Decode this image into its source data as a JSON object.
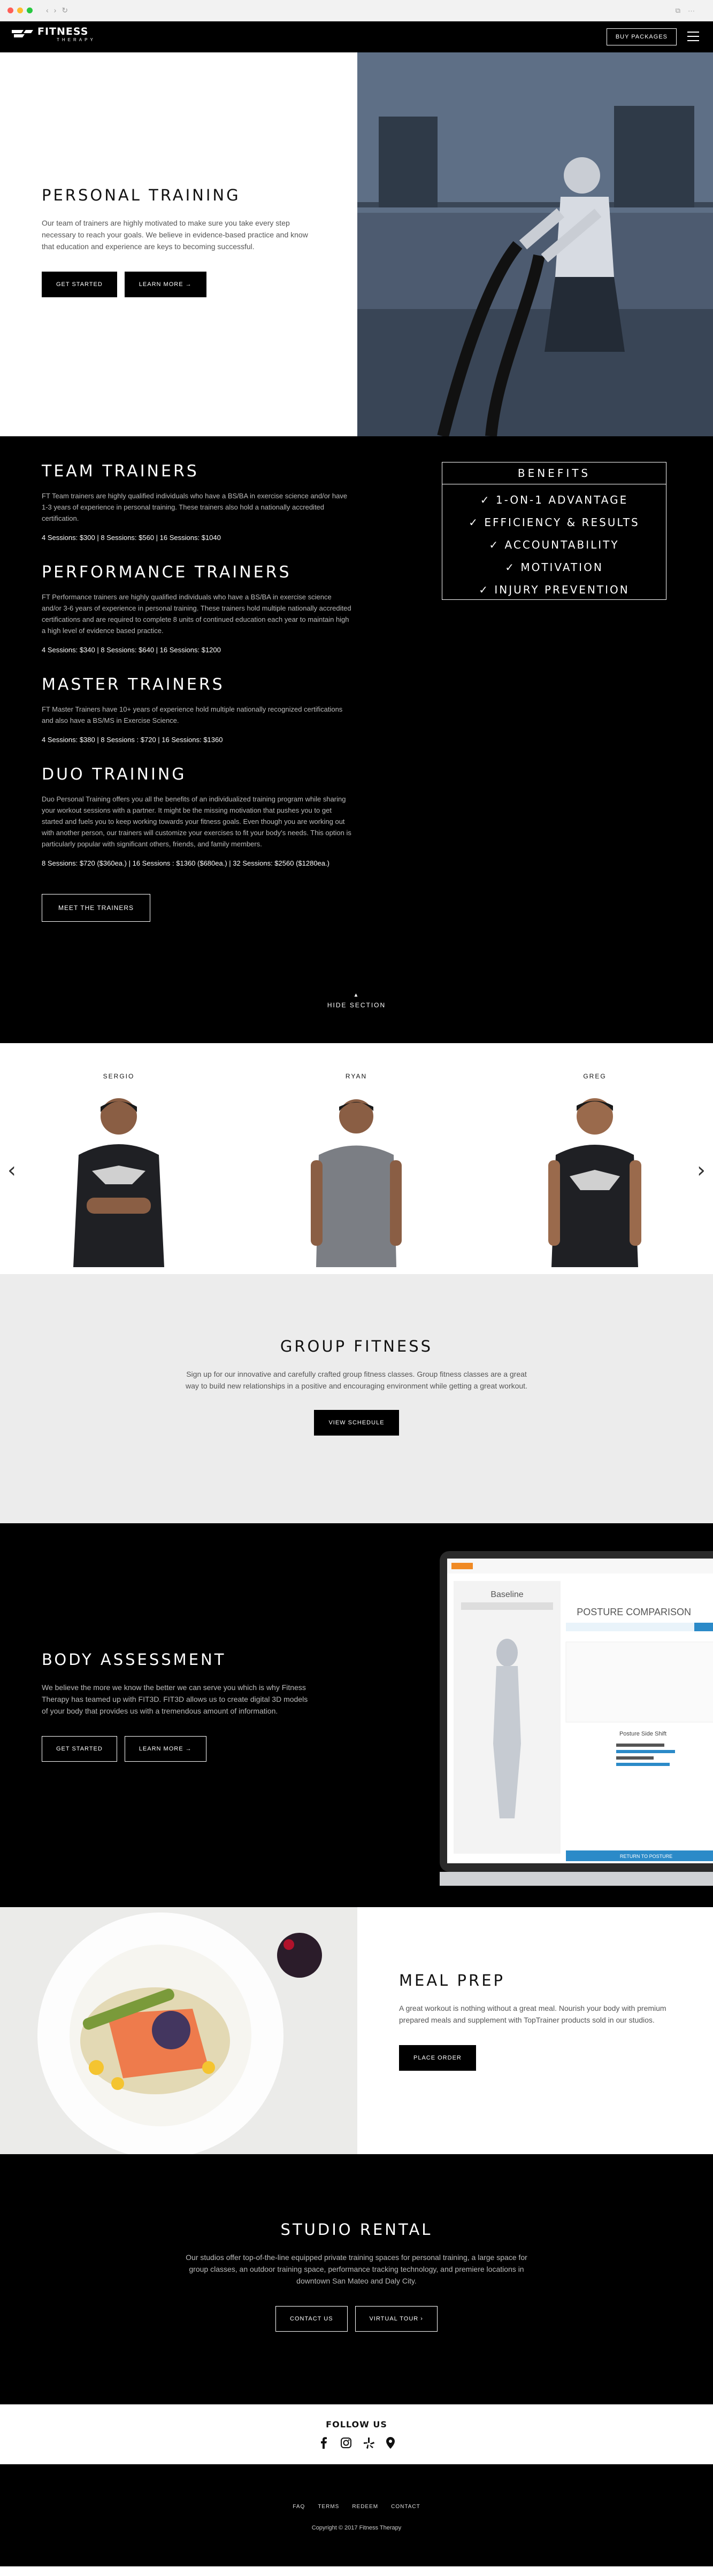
{
  "header": {
    "logo_title": "FITNESS",
    "logo_subtitle": "THERAPY",
    "buy_label": "BUY PACKAGES"
  },
  "personal_training": {
    "title": "PERSONAL TRAINING",
    "text": "Our team of trainers are highly motivated to make sure you take every step necessary to reach your goals. We believe in evidence-based practice and know that education and experience are keys to becoming successful.",
    "get_started": "GET STARTED",
    "learn_more": "LEARN MORE →"
  },
  "trainers": {
    "team": {
      "title": "TEAM TRAINERS",
      "text": "FT Team trainers are highly qualified individuals who have a BS/BA in exercise science and/or have 1-3 years of experience in personal training. These trainers also hold a nationally accredited certification.",
      "price": "4 Sessions: $300 | 8 Sessions: $560 | 16 Sessions: $1040"
    },
    "performance": {
      "title": "PERFORMANCE TRAINERS",
      "text": "FT Performance trainers are highly qualified individuals who have a BS/BA in exercise science and/or 3-6 years of experience in personal training. These trainers hold multiple nationally accredited certifications and are required to complete 8 units of continued education each year to maintain high a high level of evidence based practice.",
      "price": "4 Sessions: $340 | 8 Sessions: $640 | 16 Sessions: $1200"
    },
    "master": {
      "title": "MASTER TRAINERS",
      "text": "FT Master Trainers have 10+ years of experience hold multiple nationally recognized certifications and also have a BS/MS in Exercise Science.",
      "price": "4 Sessions: $380 | 8 Sessions : $720 | 16 Sessions: $1360"
    },
    "duo": {
      "title": "DUO TRAINING",
      "text": "Duo Personal Training offers you all the benefits of an individualized training program while sharing your workout sessions with a partner. It might be the missing motivation that pushes you to get started and fuels you to keep working towards your fitness goals. Even though you are working out with another person, our trainers will customize your exercises to fit your body's needs. This option is particularly popular with significant others, friends, and family members.",
      "price": "8 Sessions: $720 ($360ea.) | 16 Sessions : $1360 ($680ea.) | 32 Sessions: $2560 ($1280ea.)"
    },
    "meet_label": "MEET THE TRAINERS",
    "hide_label": "HIDE SECTION"
  },
  "benefits": {
    "title": "BENEFITS",
    "items": [
      "✓ 1-ON-1 ADVANTAGE",
      "✓ EFFICIENCY & RESULTS",
      "✓ ACCOUNTABILITY",
      "✓ MOTIVATION",
      "✓ INJURY PREVENTION"
    ]
  },
  "team": {
    "members": [
      "SERGIO",
      "RYAN",
      "GREG"
    ]
  },
  "group_fitness": {
    "title": "GROUP FITNESS",
    "text": "Sign up for our innovative and carefully crafted group fitness classes. Group fitness classes are a great way to build new relationships in a positive and encouraging environment while getting a great workout.",
    "button": "VIEW SCHEDULE"
  },
  "body_assessment": {
    "title": "BODY ASSESSMENT",
    "text": "We believe the more we know the better we can serve you which is why Fitness Therapy has teamed up with FIT3D. FIT3D allows us to create digital 3D models of your body that provides us with a tremendous amount of information.",
    "get_started": "GET STARTED",
    "learn_more": "LEARN MORE →",
    "screen": {
      "baseline": "Baseline",
      "posture_title": "POSTURE COMPARISON",
      "return_btn": "RETURN TO POSTURE",
      "side_shift": "Posture Side Shift"
    }
  },
  "meal_prep": {
    "title": "MEAL PREP",
    "text": "A great workout is nothing without a great meal. Nourish your body with premium prepared meals and supplement with TopTrainer products sold in our studios.",
    "button": "PLACE ORDER"
  },
  "studio_rental": {
    "title": "STUDIO RENTAL",
    "text": "Our studios offer top-of-the-line equipped private training spaces for personal training, a large space for group classes, an outdoor training space, performance tracking technology, and premiere locations in downtown San Mateo and Daly City.",
    "contact": "CONTACT US",
    "tour": "VIRTUAL TOUR ›"
  },
  "follow": {
    "title": "FOLLOW US",
    "icons": [
      "facebook-icon",
      "instagram-icon",
      "yelp-icon",
      "map-pin-icon"
    ]
  },
  "footer": {
    "links": [
      "FAQ",
      "TERMS",
      "REDEEM",
      "CONTACT"
    ],
    "copyright": "Copyright © 2017 Fitness Therapy"
  },
  "colors": {
    "black": "#000000",
    "grey_bg": "#ececec",
    "accent_blue": "#2b8ac8",
    "fit3d_orange": "#f08a24"
  }
}
